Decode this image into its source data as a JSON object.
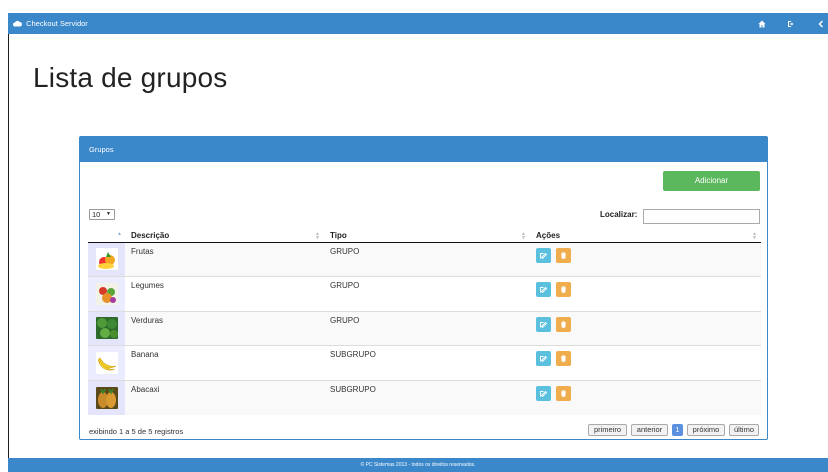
{
  "navbar": {
    "brand": "Checkout Servidor",
    "icons": [
      "home-icon",
      "sign-out-icon",
      "back-icon"
    ]
  },
  "page": {
    "title": "Lista de grupos"
  },
  "panel": {
    "heading": "Grupos",
    "add_label": "Adicionar",
    "length_value": "10",
    "search_label": "Localizar:",
    "search_value": ""
  },
  "table": {
    "columns": [
      "",
      "Descrição",
      "Tipo",
      "Ações"
    ],
    "rows": [
      {
        "descricao": "Frutas",
        "tipo": "GRUPO",
        "image": "frutas-image"
      },
      {
        "descricao": "Legumes",
        "tipo": "GRUPO",
        "image": "legumes-image"
      },
      {
        "descricao": "Verduras",
        "tipo": "GRUPO",
        "image": "verduras-image"
      },
      {
        "descricao": "Banana",
        "tipo": "SUBGRUPO",
        "image": "banana-image"
      },
      {
        "descricao": "Abacaxi",
        "tipo": "SUBGRUPO",
        "image": "abacaxi-image"
      }
    ]
  },
  "info": "exibindo 1 a 5 de 5 registros",
  "pagination": {
    "first": "primeiro",
    "prev": "anterior",
    "current": "1",
    "next": "próximo",
    "last": "último"
  },
  "footer": "© PC Sistemas 2013 - todos os direitos reservados.",
  "colors": {
    "primary": "#3a87ca",
    "success": "#5cb85c",
    "info": "#5bc0de",
    "warning": "#f0ad4e"
  }
}
